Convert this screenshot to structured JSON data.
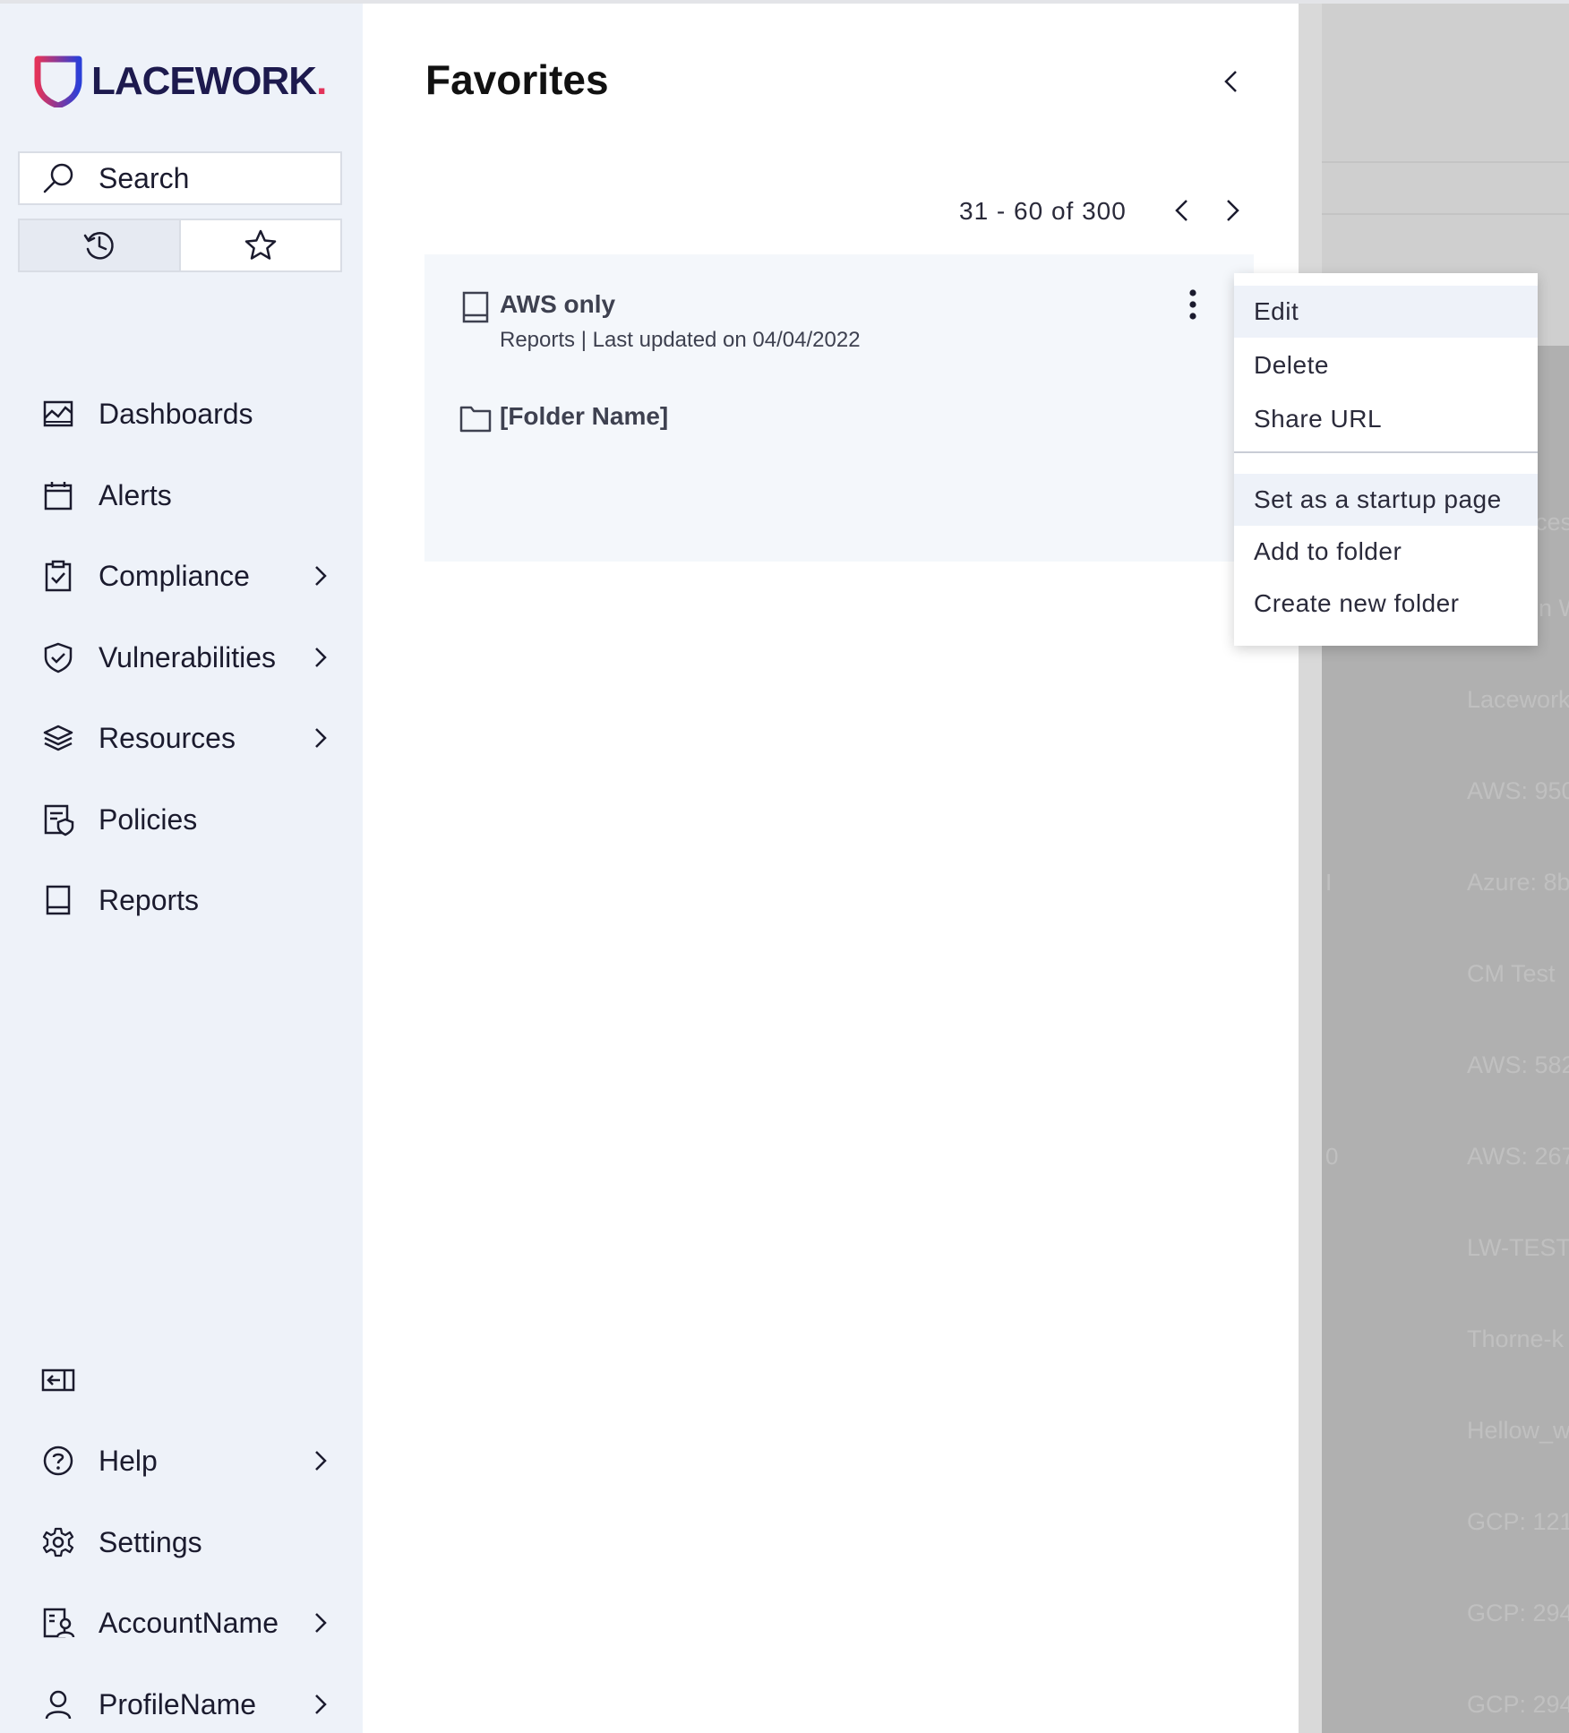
{
  "brand": {
    "name": "LACEWORK",
    "dot": "."
  },
  "search": {
    "placeholder": "Search"
  },
  "nav": {
    "items": [
      {
        "label": "Dashboards"
      },
      {
        "label": "Alerts"
      },
      {
        "label": "Compliance"
      },
      {
        "label": "Vulnerabilities"
      },
      {
        "label": "Resources"
      },
      {
        "label": "Policies"
      },
      {
        "label": "Reports"
      }
    ],
    "bottom": [
      {
        "label": "Help"
      },
      {
        "label": "Settings"
      },
      {
        "label": "AccountName"
      },
      {
        "label": "ProfileName"
      }
    ]
  },
  "favorites": {
    "title": "Favorites",
    "pagination": "31 - 60 of 300",
    "items": [
      {
        "title": "AWS only",
        "subtitle": "Reports | Last updated on 04/04/2022",
        "icon": "report-icon"
      },
      {
        "title": "[Folder Name]",
        "icon": "folder-icon"
      }
    ]
  },
  "menu": {
    "items": [
      {
        "label": "Edit"
      },
      {
        "label": "Delete"
      },
      {
        "label": "Share URL"
      },
      {
        "label": "Set as a startup page"
      },
      {
        "label": "Add to folder"
      },
      {
        "label": "Create new folder"
      }
    ]
  },
  "background": {
    "partial_rows": [
      "ces",
      "n W",
      "Lacework",
      "AWS: 950",
      "Azure: 8b",
      "CM Test",
      "AWS: 582",
      "AWS: 267",
      "LW-TEST",
      "Thorne-k",
      "Hellow_w",
      "GCP: 121",
      "GCP: 294",
      "GCP: 294"
    ],
    "partial_marks": [
      "I",
      "0"
    ]
  },
  "colors": {
    "sidebar_bg": "#eef2f9",
    "brand_navy": "#1d1a4e",
    "brand_red": "#e3335a",
    "list_bg": "#f4f7fb",
    "menu_highlight": "#eef2f9"
  }
}
